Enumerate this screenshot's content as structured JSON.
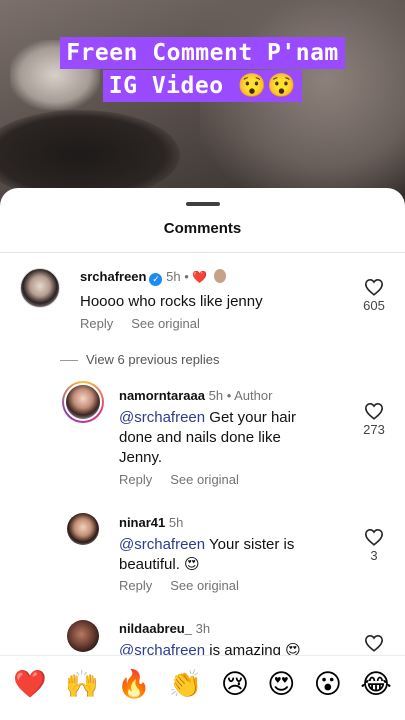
{
  "overlay": {
    "line1": "Freen Comment  P'nam",
    "line2": "IG Video 😯😯"
  },
  "sheet": {
    "title": "Comments"
  },
  "comments": [
    {
      "user": "srchafreen",
      "verified": true,
      "time": "5h",
      "extra": "❤️",
      "text": "Hoooo who rocks like jenny",
      "reply": "Reply",
      "see": "See original",
      "likes": "605"
    }
  ],
  "view_replies": "View 6 previous replies",
  "replies": [
    {
      "user": "namorntaraaa",
      "time": "5h",
      "author": "Author",
      "mention": "@srchafreen",
      "text_line1": " Get your hair",
      "text_line2": "done and nails done like",
      "text_line3": "Jenny.",
      "reply": "Reply",
      "see": "See original",
      "likes": "273"
    },
    {
      "user": "ninar41",
      "time": "5h",
      "mention": "@srchafreen",
      "text_line1": " Your sister is",
      "text_line2": "beautiful. 😍",
      "reply": "Reply",
      "see": "See original",
      "likes": "3"
    },
    {
      "user": "nildaabreu_",
      "time": "3h",
      "mention": "@srchafreen",
      "text_line1": " is amazing 😍"
    }
  ],
  "emoji_bar": [
    "❤️",
    "🙌",
    "🔥",
    "👏",
    "😢",
    "😍",
    "😮",
    "😂"
  ],
  "colors": {
    "overlay_bg": "#9a4bff",
    "mention": "#2d3c8f",
    "verified": "#1d8cf0",
    "heart": "#e0162b"
  }
}
